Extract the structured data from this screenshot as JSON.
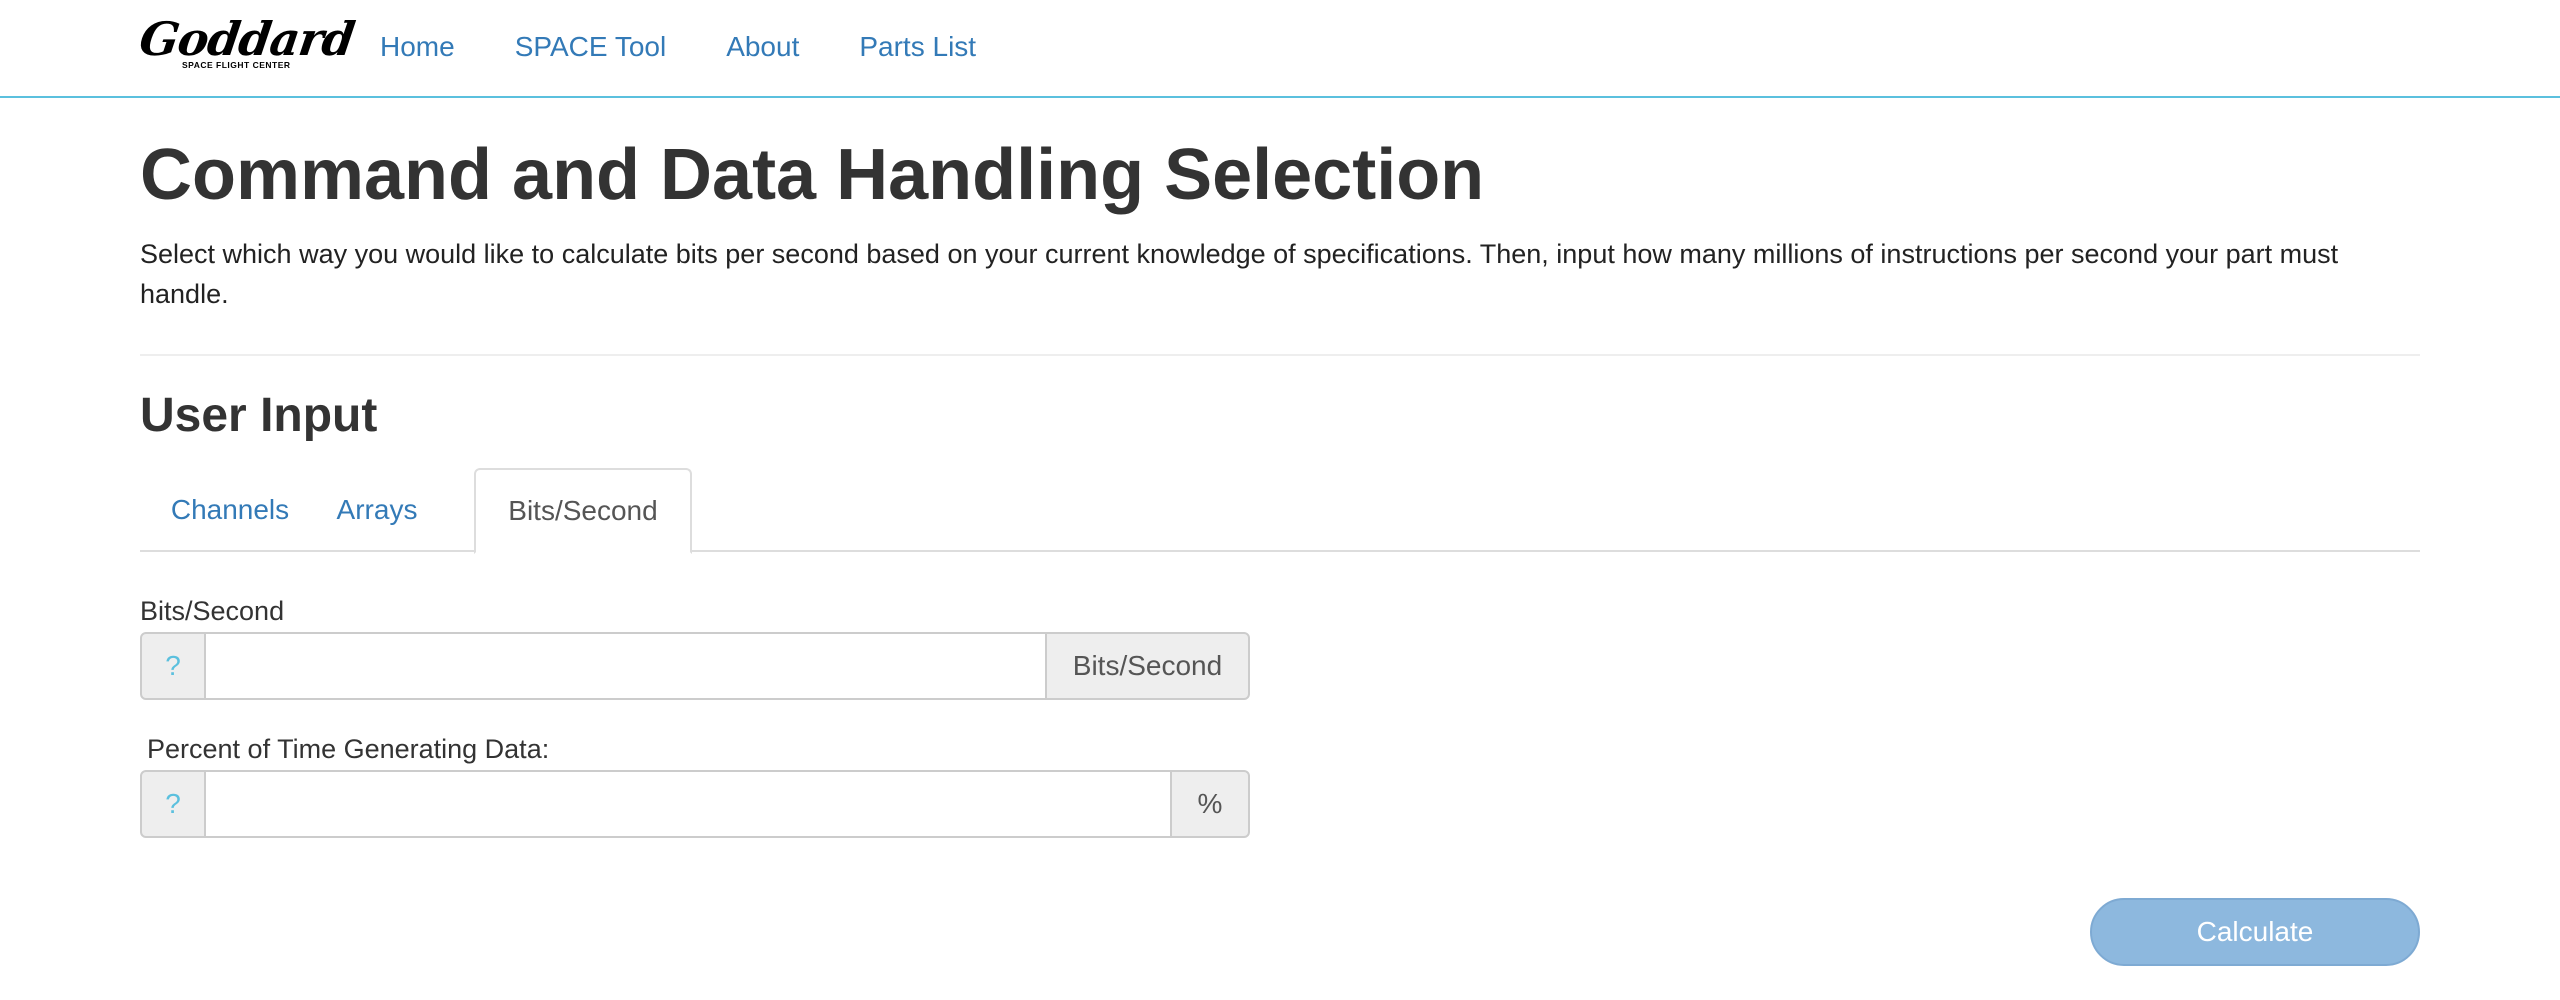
{
  "brand": {
    "logo_script": "Goddard",
    "logo_tagline": "SPACE FLIGHT CENTER"
  },
  "nav": {
    "items": [
      {
        "label": "Home"
      },
      {
        "label": "SPACE Tool"
      },
      {
        "label": "About"
      },
      {
        "label": "Parts List"
      }
    ]
  },
  "page": {
    "title": "Command and Data Handling Selection",
    "intro": "Select which way you would like to calculate bits per second based on your current knowledge of specifications. Then, input how many millions of instructions per second your part must handle."
  },
  "section": {
    "title": "User Input"
  },
  "tabs": [
    {
      "label": "Channels",
      "active": false
    },
    {
      "label": "Arrays",
      "active": false
    },
    {
      "label": "Bits/Second",
      "active": true
    }
  ],
  "form": {
    "bits_per_second": {
      "label": "Bits/Second",
      "help": "?",
      "value": "",
      "unit": "Bits/Second"
    },
    "percent_time": {
      "label": "Percent of Time Generating Data:",
      "help": "?",
      "value": "",
      "unit": "%"
    }
  },
  "actions": {
    "calculate_label": "Calculate"
  },
  "colors": {
    "link": "#337ab7",
    "navbar_border": "#5bc0de",
    "button_bg": "#8db8de",
    "help_icon": "#5bc0de"
  }
}
